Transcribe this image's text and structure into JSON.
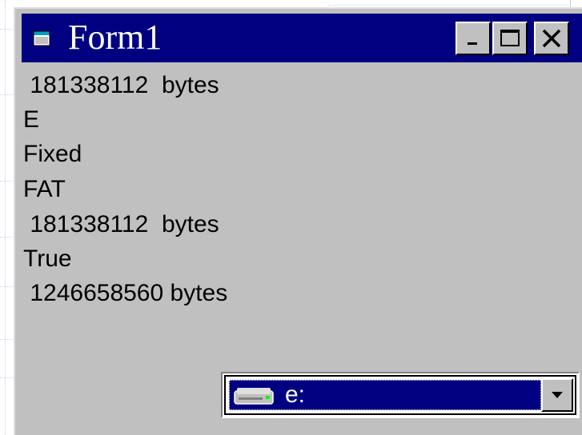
{
  "window": {
    "title": "Form1",
    "controls": {
      "minimize_icon": "minimize-icon",
      "maximize_icon": "maximize-icon",
      "close_icon": "close-icon"
    }
  },
  "output_lines": [
    " 181338112  bytes",
    "E",
    "Fixed",
    "FAT",
    " 181338112  bytes",
    "True",
    " 1246658560 bytes"
  ],
  "drive_list": {
    "selected": "e:",
    "icon": "hard-drive-icon"
  },
  "colors": {
    "titlebar": "#000080",
    "window_face": "#c0c0c0",
    "selection": "#000080"
  }
}
